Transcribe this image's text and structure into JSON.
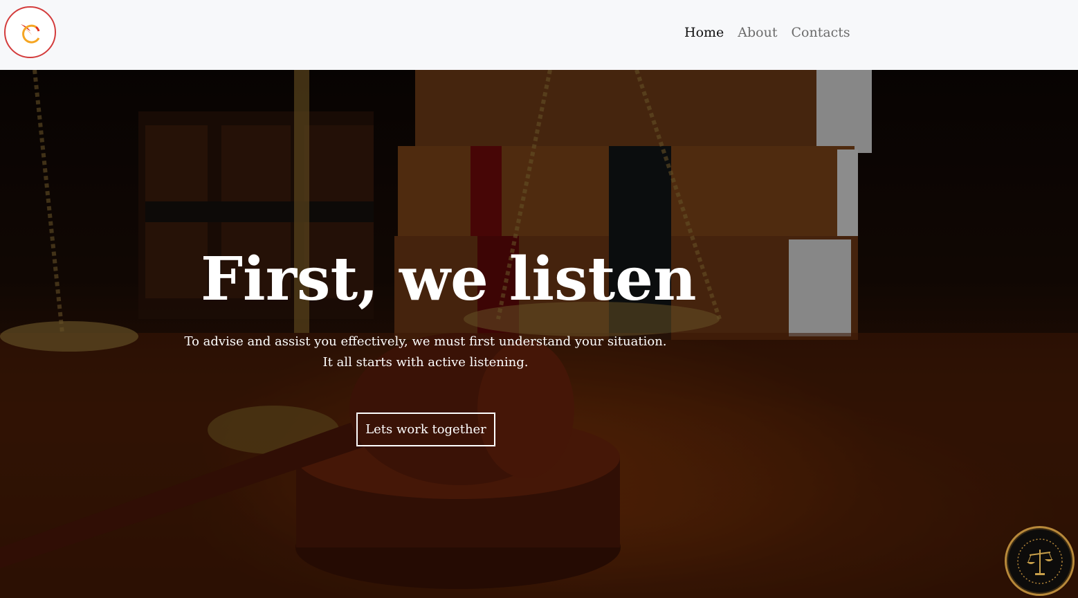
{
  "header": {
    "logo_icon": "phoenix-logo-icon",
    "nav": [
      {
        "label": "Home",
        "active": true
      },
      {
        "label": "About",
        "active": false
      },
      {
        "label": "Contacts",
        "active": false
      }
    ]
  },
  "hero": {
    "title": "First, we listen",
    "subtitle_line1": "To advise and assist you effectively, we must first understand your situation.",
    "subtitle_line2": "It all starts with active listening.",
    "cta_label": "Lets work together",
    "badge_icon": "scales-of-justice-badge-icon"
  },
  "colors": {
    "nav_bg": "#f7f8fa",
    "logo_border": "#d33b3b",
    "accent_gold": "#b8893a"
  }
}
